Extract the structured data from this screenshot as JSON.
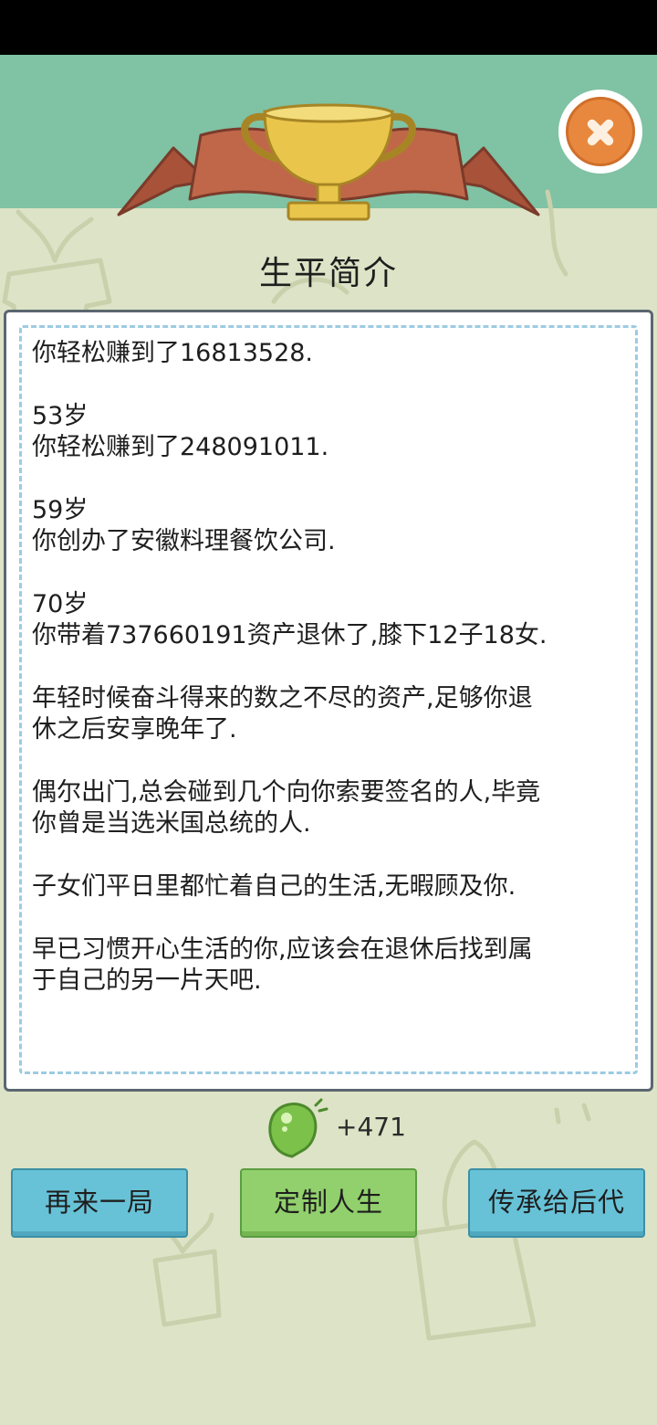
{
  "header": {
    "title": "生平简介"
  },
  "icons": {
    "close": "close-x-icon",
    "trophy": "trophy-icon",
    "ribbon": "ribbon-banner",
    "reward": "green-egg-icon"
  },
  "biography": {
    "paragraphs": [
      {
        "lines": [
          "你轻松赚到了16813528."
        ]
      },
      {
        "lines": [
          "53岁",
          "你轻松赚到了248091011."
        ]
      },
      {
        "lines": [
          "59岁",
          "你创办了安徽料理餐饮公司."
        ]
      },
      {
        "lines": [
          "70岁",
          "你带着737660191资产退休了,膝下12子18女."
        ]
      },
      {
        "lines": [
          "年轻时候奋斗得来的数之不尽的资产,足够你退",
          "休之后安享晚年了."
        ]
      },
      {
        "lines": [
          "偶尔出门,总会碰到几个向你索要签名的人,毕竟",
          "你曾是当选米国总统的人."
        ]
      },
      {
        "lines": [
          "子女们平日里都忙着自己的生活,无暇顾及你."
        ]
      },
      {
        "lines": [
          "早已习惯开心生活的你,应该会在退休后找到属",
          "于自己的另一片天吧."
        ]
      }
    ]
  },
  "reward": {
    "amount": "+471"
  },
  "actions": {
    "restart_label": "再来一局",
    "customize_label": "定制人生",
    "inherit_label": "传承给后代"
  },
  "colors": {
    "background": "#dde3c6",
    "top_band": "#7fc2a4",
    "ribbon": "#c0674a",
    "trophy": "#e9c64b",
    "close_button": "#e8883e",
    "panel_border": "#5b6670",
    "dashed_border": "#9dcbe1",
    "button_blue": "#67c2d7",
    "button_green": "#91d06c"
  }
}
